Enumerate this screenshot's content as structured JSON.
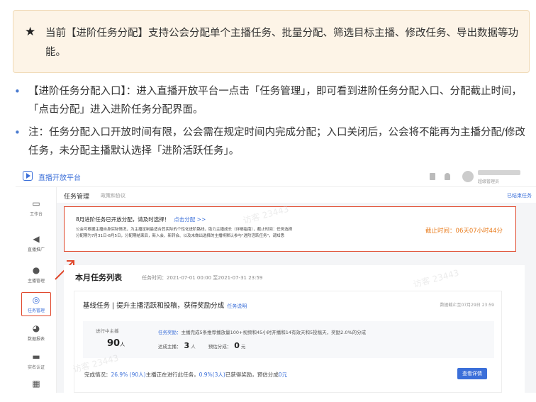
{
  "tip": {
    "icon": "star-icon",
    "text": "当前【进阶任务分配】支持公会分配单个主播任务、批量分配、筛选目标主播、修改任务、导出数据等功能。"
  },
  "bullets": [
    {
      "text": "【进阶任务分配入口】：进入直播开放平台一点击「任务管理」，即可看到进阶任务分配入口、分配截止时间，「点击分配」进入进阶任务分配界面。"
    },
    {
      "text": "注：任务分配入口开放时间有限，公会需在规定时间内完成分配；入口关闭后，公会将不能再为主播分配/修改任务，未分配主播默认选择「进阶活跃任务」。"
    }
  ],
  "screenshot": {
    "brand": "直播开放平台",
    "user_role": "超级管理员",
    "header": {
      "title": "任务管理",
      "subtitle": "政策和协议",
      "right_link": "已结束任务"
    },
    "sidebar": [
      {
        "label": "工作台",
        "icon": "monitor-icon"
      },
      {
        "label": "直播推广",
        "icon": "megaphone-icon"
      },
      {
        "label": "主播管理",
        "icon": "users-icon"
      },
      {
        "label": "任务管理",
        "icon": "target-icon"
      },
      {
        "label": "数据报表",
        "icon": "pie-chart-icon"
      },
      {
        "label": "实名认证",
        "icon": "flag-icon"
      },
      {
        "label": "",
        "icon": "gift-icon"
      }
    ],
    "notice": {
      "title": "8月进阶任务已开放分配，请及时选择！",
      "link": "点击分配 >>",
      "body": "公会可根据主播自身实际情况，为主播定制最适合其实际的个性化进阶路线，助力主播成长（详细指南），截止时间：任务选择分配期为7月31日-8月5日，分配期结束后，新入会、新转会、以及未做出选择的主播将默认参与\"进阶活跃任务\"，请知悉",
      "deadline": "截止时间：06天07小时44分"
    },
    "month_list": {
      "title": "本月任务列表",
      "period": "任务时间：2021-07-01 00:00 至2021-07-31 23:59"
    },
    "baseline": {
      "title": "基线任务 | 提升主播活跃和投稿，获得奖励分成",
      "link": "任务说明",
      "update": "数据截止至07月29日 23:59",
      "in_progress_label": "进行中主播",
      "in_progress_count": "90",
      "in_progress_unit": "人",
      "reward": "主播完成5条推荐播放量100+视频和45小时开播和14有效天和5投稿天，奖励2.0%的分成",
      "reward_label": "任务奖励：",
      "achieved_label": "达成主播：",
      "achieved_count": "3",
      "achieved_unit": "人",
      "estimate_label": "预估分成：",
      "estimate_count": "0",
      "estimate_unit": "元",
      "completion_label": "完成情况：",
      "completion_a": "26.9% (90人)",
      "completion_b": "主播正在进行此任务，",
      "completion_c": "0.9%(3人)",
      "completion_d": "已获得奖励，预估分成",
      "completion_e": "0元",
      "button": "查看详情"
    },
    "watermark": "访客 23443"
  }
}
